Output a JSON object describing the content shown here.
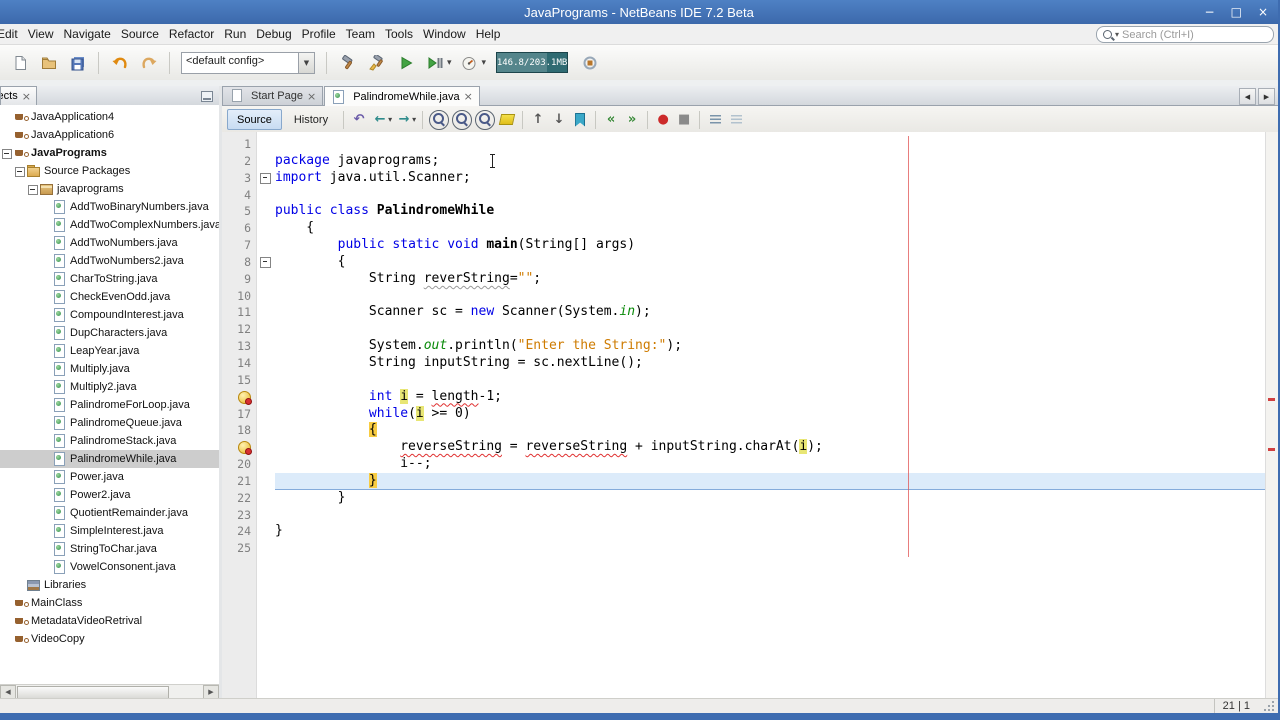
{
  "glyphs": {
    "minimize": "−",
    "maximize": "□",
    "close": "×",
    "tab_close": "×",
    "combo_arrow": "▼",
    "scroll_left": "◀",
    "scroll_right": "▶",
    "dropdown": "▾",
    "search_dropdown": "▾"
  },
  "colors": {
    "keyword": "#0000e6",
    "string": "#ce7b00",
    "error_underline": "#e03030",
    "occurrence_bg": "#e8e675",
    "brace_bg": "#f8cc42",
    "current_line_bg": "#dcebfa",
    "margin_line": "#e05252",
    "memory_bg": "#2f6b72"
  },
  "window": {
    "title": "JavaPrograms - NetBeans IDE 7.2 Beta"
  },
  "menubar": {
    "items": [
      "Edit",
      "View",
      "Navigate",
      "Source",
      "Refactor",
      "Run",
      "Debug",
      "Profile",
      "Team",
      "Tools",
      "Window",
      "Help"
    ],
    "search_placeholder": "Search (Ctrl+I)"
  },
  "toolbar": {
    "config_value": "<default config>",
    "memory_label": "146.8/203.1MB",
    "icons": [
      "new-file",
      "open-project",
      "save-all",
      "undo",
      "redo",
      "build",
      "clean-build",
      "run",
      "debug",
      "profile",
      "gc"
    ]
  },
  "projects_panel": {
    "tab_label": "Projects",
    "tree": [
      {
        "depth": 0,
        "icon": "project",
        "label": "JavaApplication4"
      },
      {
        "depth": 0,
        "icon": "project",
        "label": "JavaApplication6"
      },
      {
        "depth": 0,
        "icon": "project",
        "label": "JavaPrograms",
        "expander": "minus",
        "bold": true
      },
      {
        "depth": 1,
        "icon": "folder",
        "label": "Source Packages",
        "expander": "minus"
      },
      {
        "depth": 2,
        "icon": "package",
        "label": "javaprograms",
        "expander": "minus"
      },
      {
        "depth": 3,
        "icon": "class",
        "label": "AddTwoBinaryNumbers.java"
      },
      {
        "depth": 3,
        "icon": "class",
        "label": "AddTwoComplexNumbers.java"
      },
      {
        "depth": 3,
        "icon": "class",
        "label": "AddTwoNumbers.java"
      },
      {
        "depth": 3,
        "icon": "class",
        "label": "AddTwoNumbers2.java"
      },
      {
        "depth": 3,
        "icon": "class",
        "label": "CharToString.java"
      },
      {
        "depth": 3,
        "icon": "class",
        "label": "CheckEvenOdd.java"
      },
      {
        "depth": 3,
        "icon": "class",
        "label": "CompoundInterest.java"
      },
      {
        "depth": 3,
        "icon": "class",
        "label": "DupCharacters.java"
      },
      {
        "depth": 3,
        "icon": "class",
        "label": "LeapYear.java"
      },
      {
        "depth": 3,
        "icon": "class",
        "label": "Multiply.java"
      },
      {
        "depth": 3,
        "icon": "class",
        "label": "Multiply2.java"
      },
      {
        "depth": 3,
        "icon": "class",
        "label": "PalindromeForLoop.java"
      },
      {
        "depth": 3,
        "icon": "class",
        "label": "PalindromeQueue.java"
      },
      {
        "depth": 3,
        "icon": "class",
        "label": "PalindromeStack.java"
      },
      {
        "depth": 3,
        "icon": "class",
        "label": "PalindromeWhile.java",
        "selected": true
      },
      {
        "depth": 3,
        "icon": "class",
        "label": "Power.java"
      },
      {
        "depth": 3,
        "icon": "class",
        "label": "Power2.java"
      },
      {
        "depth": 3,
        "icon": "class",
        "label": "QuotientRemainder.java"
      },
      {
        "depth": 3,
        "icon": "class",
        "label": "SimpleInterest.java"
      },
      {
        "depth": 3,
        "icon": "class",
        "label": "StringToChar.java"
      },
      {
        "depth": 3,
        "icon": "class",
        "label": "VowelConsonent.java"
      },
      {
        "depth": 1,
        "icon": "libraries",
        "label": "Libraries"
      },
      {
        "depth": 0,
        "icon": "project",
        "label": "MainClass"
      },
      {
        "depth": 0,
        "icon": "project",
        "label": "MetadataVideoRetrival"
      },
      {
        "depth": 0,
        "icon": "project",
        "label": "VideoCopy"
      }
    ]
  },
  "editor": {
    "tabs": [
      {
        "label": "Start Page",
        "active": false,
        "icon": "page"
      },
      {
        "label": "PalindromeWhile.java",
        "active": true,
        "icon": "class"
      }
    ],
    "toolbar": {
      "source_label": "Source",
      "history_label": "History",
      "icons": [
        {
          "name": "last-edit-icon",
          "glyph": "↶",
          "color": "#6a5aa8"
        },
        {
          "name": "back-icon",
          "glyph": "←",
          "color": "#2e8b8b",
          "dd": true
        },
        {
          "name": "forward-icon",
          "glyph": "→",
          "color": "#2e8b8b",
          "dd": true
        },
        {
          "sep": true
        },
        {
          "name": "find-selection-icon",
          "kind": "mag"
        },
        {
          "name": "find-previous-occurrence-icon",
          "kind": "mag"
        },
        {
          "name": "find-next-occurrence-icon",
          "kind": "mag"
        },
        {
          "name": "toggle-highlight-search-icon",
          "kind": "marker"
        },
        {
          "sep": true
        },
        {
          "name": "previous-bookmark-icon",
          "glyph": "↑",
          "color": "#555555"
        },
        {
          "name": "next-bookmark-icon",
          "glyph": "↓",
          "color": "#555555"
        },
        {
          "name": "toggle-bookmark-icon",
          "kind": "bookmark"
        },
        {
          "sep": true
        },
        {
          "name": "shift-line-left-icon",
          "glyph": "«",
          "color": "#3a8b3a"
        },
        {
          "name": "shift-line-right-icon",
          "glyph": "»",
          "color": "#3a8b3a"
        },
        {
          "sep": true
        },
        {
          "name": "record-macro-icon",
          "glyph": "●",
          "color": "#cc2a2a"
        },
        {
          "name": "stop-macro-icon",
          "glyph": "■",
          "color": "#8a8a8a"
        },
        {
          "sep": true
        },
        {
          "name": "comment-icon",
          "kind": "comment"
        },
        {
          "name": "uncomment-icon",
          "kind": "uncomment"
        }
      ]
    },
    "code": {
      "lines": [
        {
          "n": 1,
          "seg": []
        },
        {
          "n": 2,
          "seg": [
            {
              "t": "package",
              "c": "k"
            },
            {
              "t": " javaprograms;"
            }
          ]
        },
        {
          "n": 3,
          "fold": true,
          "seg": [
            {
              "t": "import",
              "c": "k"
            },
            {
              "t": " java.util.Scanner;"
            }
          ]
        },
        {
          "n": 4,
          "seg": []
        },
        {
          "n": 5,
          "seg": [
            {
              "t": "public",
              "c": "k"
            },
            {
              "t": " "
            },
            {
              "t": "class",
              "c": "k"
            },
            {
              "t": " "
            },
            {
              "t": "PalindromeWhile",
              "c": "b"
            }
          ]
        },
        {
          "n": 6,
          "seg": [
            {
              "t": "    {"
            }
          ]
        },
        {
          "n": 7,
          "seg": [
            {
              "t": "        "
            },
            {
              "t": "public",
              "c": "k"
            },
            {
              "t": " "
            },
            {
              "t": "static",
              "c": "k"
            },
            {
              "t": " "
            },
            {
              "t": "void",
              "c": "k"
            },
            {
              "t": " "
            },
            {
              "t": "main",
              "c": "b"
            },
            {
              "t": "(String[] args)"
            }
          ]
        },
        {
          "n": 8,
          "fold": true,
          "seg": [
            {
              "t": "        {"
            }
          ]
        },
        {
          "n": 9,
          "seg": [
            {
              "t": "            String "
            },
            {
              "t": "reverString",
              "c": "w"
            },
            {
              "t": "="
            },
            {
              "t": "\"\"",
              "c": "s"
            },
            {
              "t": ";"
            }
          ]
        },
        {
          "n": 10,
          "seg": []
        },
        {
          "n": 11,
          "seg": [
            {
              "t": "            Scanner sc = "
            },
            {
              "t": "new",
              "c": "k"
            },
            {
              "t": " Scanner(System."
            },
            {
              "t": "in",
              "c": "f"
            },
            {
              "t": ");"
            }
          ]
        },
        {
          "n": 12,
          "seg": []
        },
        {
          "n": 13,
          "seg": [
            {
              "t": "            System."
            },
            {
              "t": "out",
              "c": "f"
            },
            {
              "t": ".println("
            },
            {
              "t": "\"Enter the String:\"",
              "c": "s"
            },
            {
              "t": ");"
            }
          ]
        },
        {
          "n": 14,
          "seg": [
            {
              "t": "            String inputString = sc.nextLine();"
            }
          ]
        },
        {
          "n": 15,
          "seg": []
        },
        {
          "n": 16,
          "err": true,
          "seg": [
            {
              "t": "            "
            },
            {
              "t": "int",
              "c": "k"
            },
            {
              "t": " "
            },
            {
              "t": "i",
              "c": "h"
            },
            {
              "t": " = "
            },
            {
              "t": "length",
              "c": "e"
            },
            {
              "t": "-1;"
            }
          ]
        },
        {
          "n": 17,
          "seg": [
            {
              "t": "            "
            },
            {
              "t": "while",
              "c": "k"
            },
            {
              "t": "("
            },
            {
              "t": "i",
              "c": "h"
            },
            {
              "t": " >= 0)"
            }
          ]
        },
        {
          "n": 18,
          "seg": [
            {
              "t": "            "
            },
            {
              "t": "{",
              "c": "m"
            }
          ]
        },
        {
          "n": 19,
          "err": true,
          "seg": [
            {
              "t": "                "
            },
            {
              "t": "reverseString",
              "c": "e"
            },
            {
              "t": " = "
            },
            {
              "t": "reverseString",
              "c": "e"
            },
            {
              "t": " + inputString.charAt("
            },
            {
              "t": "i",
              "c": "h"
            },
            {
              "t": ");"
            }
          ]
        },
        {
          "n": 20,
          "seg": [
            {
              "t": "                i--;"
            }
          ]
        },
        {
          "n": 21,
          "cur": true,
          "seg": [
            {
              "t": "            "
            },
            {
              "t": "}",
              "c": "m"
            }
          ]
        },
        {
          "n": 22,
          "seg": [
            {
              "t": "        }"
            }
          ]
        },
        {
          "n": 23,
          "seg": []
        },
        {
          "n": 24,
          "seg": [
            {
              "t": "}"
            }
          ]
        },
        {
          "n": 25,
          "seg": []
        }
      ]
    }
  },
  "statusbar": {
    "caret": "21 | 1"
  }
}
